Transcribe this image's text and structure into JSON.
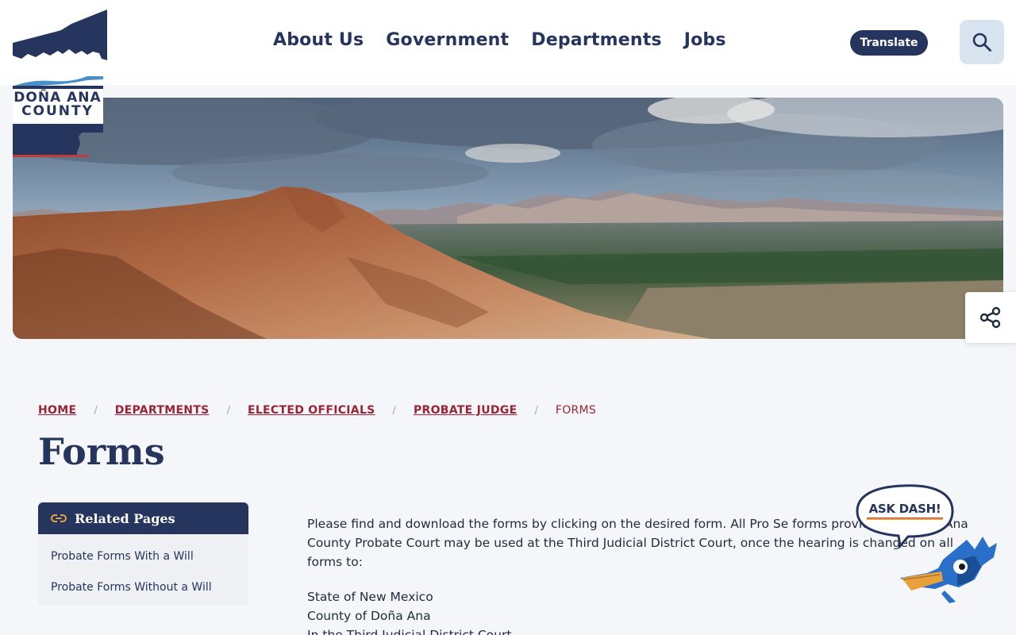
{
  "logo": {
    "line1": "DOÑA ANA",
    "line2": "COUNTY"
  },
  "nav": {
    "items": [
      "About Us",
      "Government",
      "Departments",
      "Jobs"
    ]
  },
  "header": {
    "translate_label": "Translate"
  },
  "icons": {
    "search": "search-icon",
    "share": "share-icon",
    "link": "link-icon"
  },
  "breadcrumb": {
    "items": [
      "HOME",
      "DEPARTMENTS",
      "ELECTED OFFICIALS",
      "PROBATE JUDGE"
    ],
    "current": "FORMS",
    "separator": "/"
  },
  "page": {
    "title": "Forms"
  },
  "related": {
    "title": "Related Pages",
    "items": [
      "Probate Forms With a Will",
      "Probate Forms Without a Will"
    ]
  },
  "content": {
    "intro": "Please find and download the forms by clicking on the desired form.  All Pro Se forms provided by Doña Ana County Probate Court may be used at the Third Judicial District Court, once the hearing is changed on all forms to:",
    "address": [
      "State of New Mexico",
      "County of Doña Ana",
      "In the Third Judicial District Court"
    ]
  },
  "ask_dash": {
    "label": "ASK DASH!"
  },
  "colors": {
    "navy": "#25355e",
    "maroon": "#9b2335",
    "accent": "#e8a33d",
    "background": "#f5f6fa"
  }
}
